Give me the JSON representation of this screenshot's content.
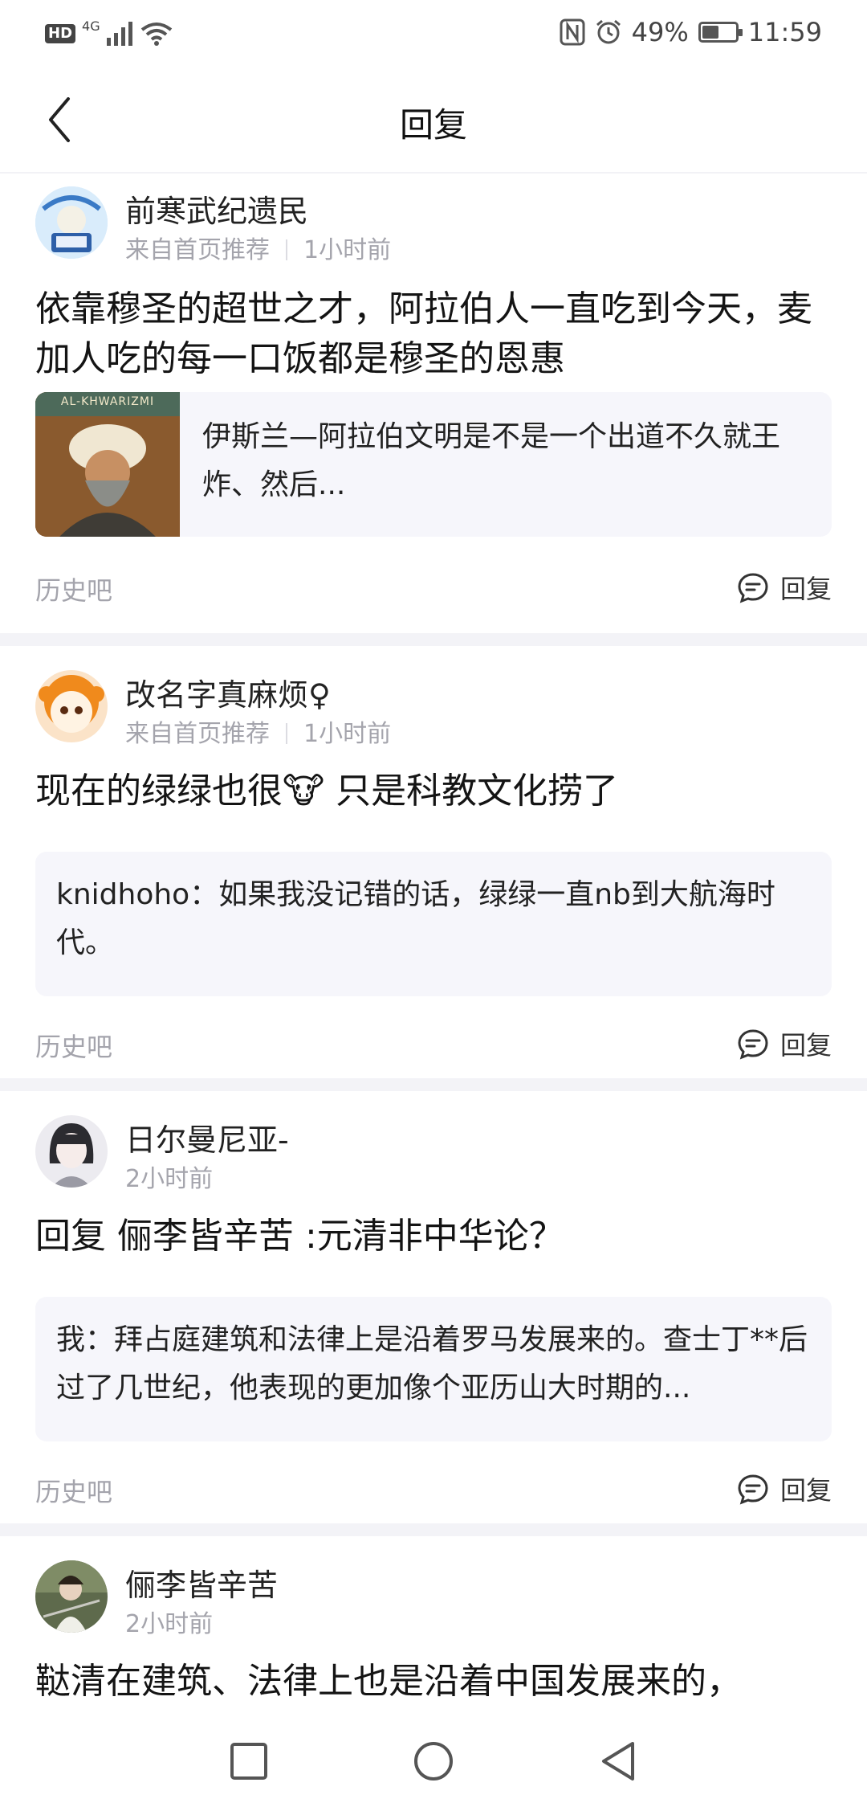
{
  "status_bar": {
    "hd": "HD",
    "network": "4G",
    "battery_percent": "49%",
    "battery_level": 0.49,
    "time": "11:59"
  },
  "header": {
    "title": "回复",
    "back_icon": "chevron-left-icon"
  },
  "posts": [
    {
      "username": "前寒武纪遗民",
      "source": "来自首页推荐",
      "time": "1小时前",
      "text": "依靠穆圣的超世之才，阿拉伯人一直吃到今天，麦加人吃的每一口饭都是穆圣的恩惠",
      "quote": "伊斯兰—阿拉伯文明是不是一个出道不久就王炸、然后...",
      "thumb_caption": "AL-KHWARIZMI",
      "forum": "历史吧",
      "reply_label": "回复"
    },
    {
      "username": "改名字真麻烦♀",
      "source": "来自首页推荐",
      "time": "1小时前",
      "text": "现在的绿绿也很",
      "text_after": " 只是科教文化捞了",
      "emoji": "🐮",
      "quote": "knidhoho：如果我没记错的话，绿绿一直nb到大航海时代。",
      "forum": "历史吧",
      "reply_label": "回复"
    },
    {
      "username": "日尔曼尼亚-",
      "time": "2小时前",
      "text": "回复 俪李皆辛苦 :元清非中华论？",
      "quote": "我：拜占庭建筑和法律上是沿着罗马发展来的。查士丁**后过了几世纪，他表现的更加像个亚历山大时期的...",
      "forum": "历史吧",
      "reply_label": "回复"
    },
    {
      "username": "俪李皆辛苦",
      "time": "2小时前",
      "text": "鞑清在建筑、法律上也是沿着中国发展来的，"
    }
  ],
  "nav": {
    "recent_icon": "square-icon",
    "home_icon": "circle-icon",
    "back_icon": "triangle-back-icon"
  }
}
